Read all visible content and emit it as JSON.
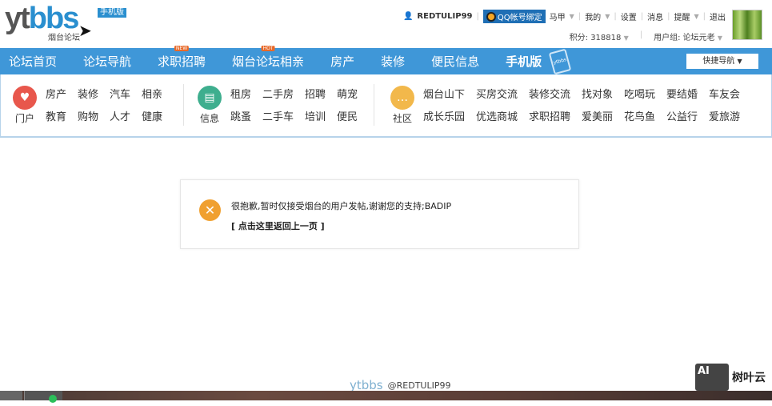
{
  "header": {
    "logo": "ytbbs",
    "logo_sub": "烟台论坛",
    "mobile_badge": "手机版",
    "username": "REDTULIP99",
    "qq_bind": "QQ帐号绑定",
    "menu": [
      "马甲",
      "我的",
      "设置",
      "消息",
      "提醒",
      "退出"
    ],
    "points": "积分: 318818",
    "usergroup": "用户组: 论坛元老"
  },
  "nav": {
    "items": [
      {
        "label": "论坛首页"
      },
      {
        "label": "论坛导航"
      },
      {
        "label": "求职招聘",
        "tag": "NEW"
      },
      {
        "label": "烟台论坛相亲",
        "tag": "HOT"
      },
      {
        "label": "房产"
      },
      {
        "label": "装修"
      },
      {
        "label": "便民信息"
      },
      {
        "label": "手机版"
      }
    ],
    "phone_text": "ytbbs",
    "quick_nav": "快捷导航"
  },
  "categories": [
    {
      "label": "门户",
      "links": [
        "房产",
        "装修",
        "汽车",
        "相亲",
        "教育",
        "购物",
        "人才",
        "健康"
      ]
    },
    {
      "label": "信息",
      "links": [
        "租房",
        "二手房",
        "招聘",
        "萌宠",
        "跳蚤",
        "二手车",
        "培训",
        "便民"
      ]
    },
    {
      "label": "社区",
      "links": [
        "烟台山下",
        "买房交流",
        "装修交流",
        "找对象",
        "吃喝玩",
        "要结婚",
        "车友会",
        "成长乐园",
        "优选商城",
        "求职招聘",
        "爱美丽",
        "花鸟鱼",
        "公益行",
        "爱旅游"
      ]
    }
  ],
  "message": {
    "text": "很抱歉,暂时仅接受烟台的用户发帖,谢谢您的支持;BADIP",
    "back_link": "[ 点击这里返回上一页 ]"
  },
  "watermark": {
    "logo": "ytbbs",
    "user": "@REDTULIP99",
    "brand_icon": "AI",
    "brand": "树叶云"
  },
  "colors": {
    "nav": "#3f97d8",
    "error_icon": "#f0a030"
  }
}
